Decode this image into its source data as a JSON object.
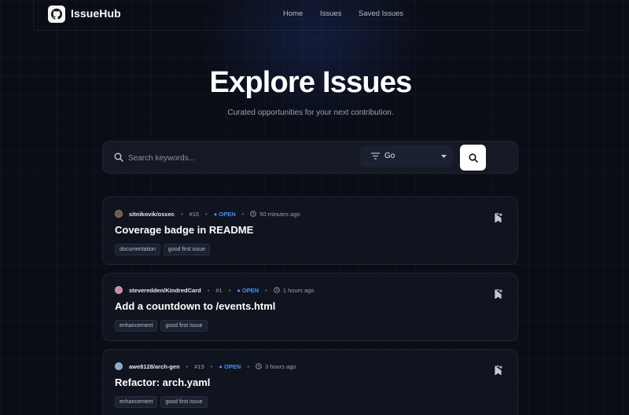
{
  "app": {
    "brand": "IssueHub"
  },
  "nav": {
    "links": [
      "Home",
      "Issues",
      "Saved Issues"
    ]
  },
  "hero": {
    "title": "Explore Issues",
    "subtitle": "Curated opportunities for your next contribution."
  },
  "search": {
    "placeholder": "Search keywords...",
    "value": "",
    "sort_value": "Go",
    "icons": {
      "search": "search-icon",
      "filter": "filter-icon",
      "caret": "chevron-down-icon"
    }
  },
  "issues": [
    {
      "repo": "sitnikovik/osxec",
      "number": "#16",
      "status": "OPEN",
      "time": "50 minutes ago",
      "title": "Coverage badge in README",
      "labels": [
        "documentation",
        "good first issue"
      ],
      "avatar_color": "#6b5a4a"
    },
    {
      "repo": "steveredden/KindredCard",
      "number": "#1",
      "status": "OPEN",
      "time": "1 hours ago",
      "title": "Add a countdown to /events.html",
      "labels": [
        "enhancement",
        "good first issue"
      ],
      "avatar_color": "#c98aa0"
    },
    {
      "repo": "awe8128/arch-gen",
      "number": "#19",
      "status": "OPEN",
      "time": "3 hours ago",
      "title": "Refactor: arch.yaml",
      "labels": [
        "enhancement",
        "good first issue"
      ],
      "avatar_color": "#8aa6c9"
    }
  ],
  "colors": {
    "background": "#0a0d16",
    "card": "#10141f",
    "status_open": "#4c8ef7",
    "button": "#ffffff"
  }
}
